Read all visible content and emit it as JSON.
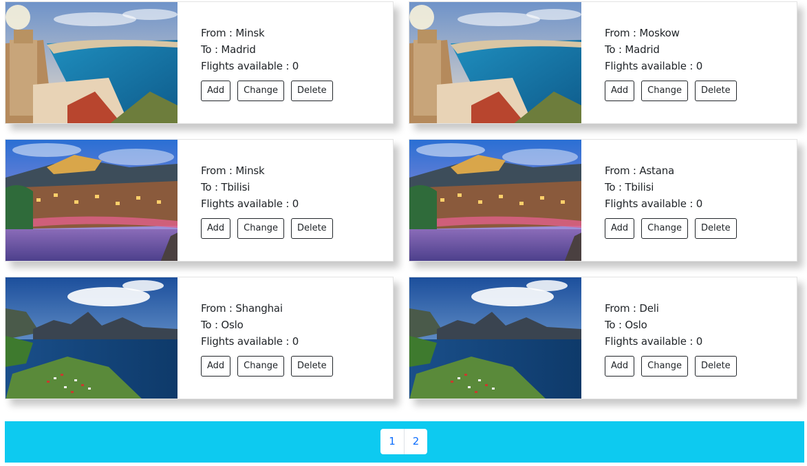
{
  "labels": {
    "from_prefix": "From : ",
    "to_prefix": "To : ",
    "flights_prefix": "Flights available : "
  },
  "buttons": {
    "add": "Add",
    "change": "Change",
    "delete": "Delete"
  },
  "cards": [
    {
      "from": "Minsk",
      "to": "Madrid",
      "flights": "0",
      "image": "coastal-town-photo"
    },
    {
      "from": "Moskow",
      "to": "Madrid",
      "flights": "0",
      "image": "coastal-town-photo"
    },
    {
      "from": "Minsk",
      "to": "Tbilisi",
      "flights": "0",
      "image": "night-city-photo"
    },
    {
      "from": "Astana",
      "to": "Tbilisi",
      "flights": "0",
      "image": "night-city-photo"
    },
    {
      "from": "Shanghai",
      "to": "Oslo",
      "flights": "0",
      "image": "fjord-mountains-photo"
    },
    {
      "from": "Deli",
      "to": "Oslo",
      "flights": "0",
      "image": "fjord-mountains-photo"
    }
  ],
  "pagination": {
    "pages": [
      "1",
      "2"
    ]
  },
  "colors": {
    "footer": "#0dcaf0",
    "page_link": "#0d6efd"
  }
}
